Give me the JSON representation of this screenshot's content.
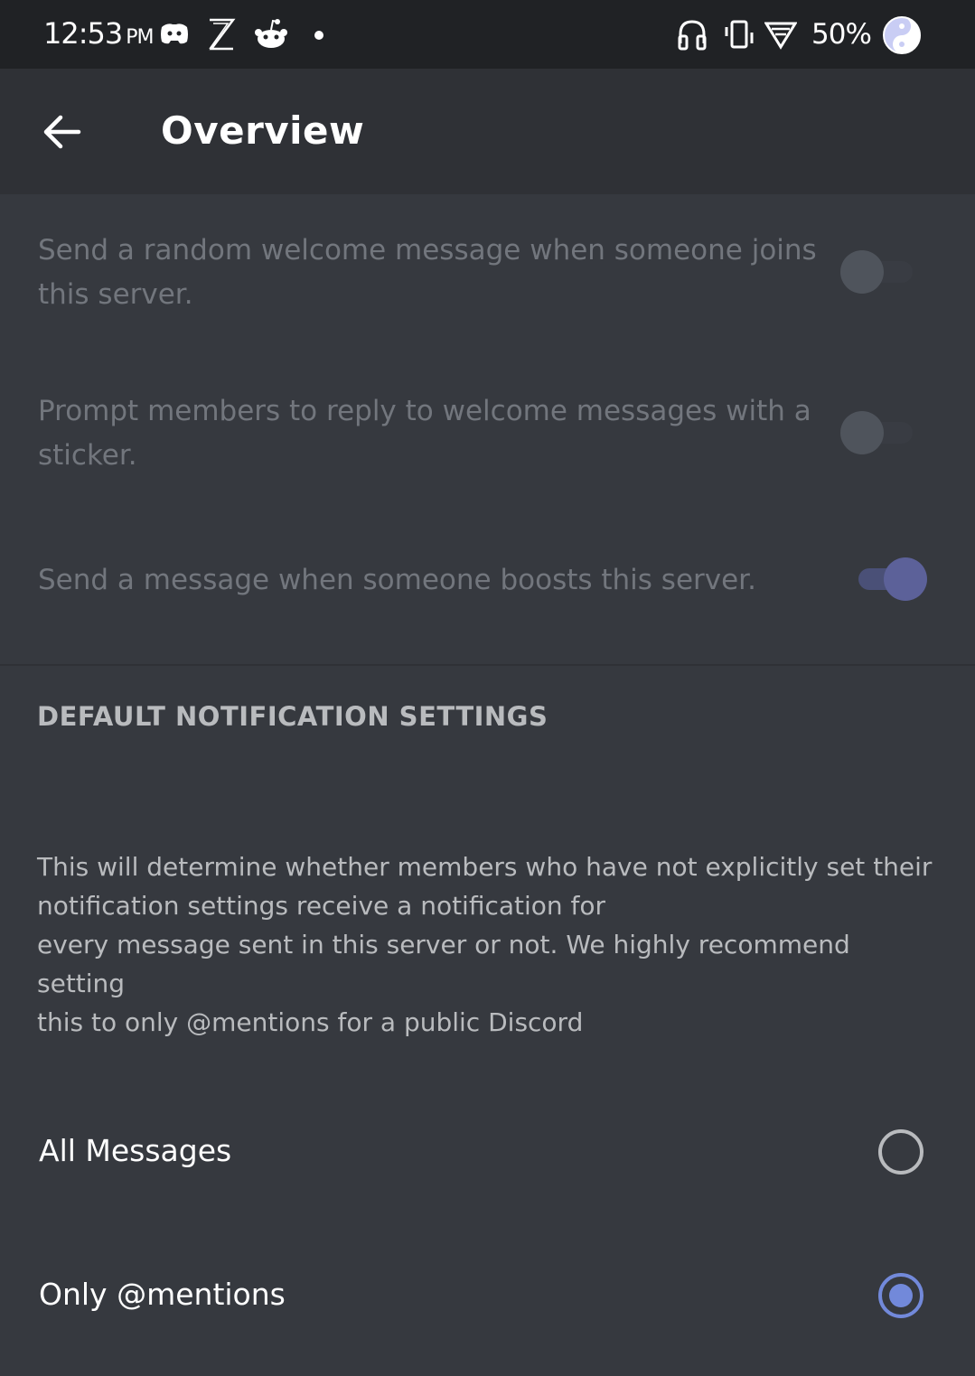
{
  "status_bar": {
    "time": "12:53",
    "ampm": "PM",
    "battery": "50%",
    "left_icons": [
      "discord-icon",
      "z-icon",
      "reddit-icon",
      "dot-icon"
    ],
    "right_icons": [
      "headphones-icon",
      "vibrate-icon",
      "wifi-icon",
      "yin-yang-icon"
    ]
  },
  "app_bar": {
    "title": "Overview",
    "back_icon": "arrow-left-icon"
  },
  "toggles": [
    {
      "label": "Send a random welcome message when someone joins this server.",
      "state": "off"
    },
    {
      "label": "Prompt members to reply to welcome messages with a sticker.",
      "state": "off"
    },
    {
      "label": "Send a message when someone boosts this server.",
      "state": "on"
    }
  ],
  "notifications": {
    "header": "DEFAULT NOTIFICATION SETTINGS",
    "description_lines": [
      "This will determine whether members who have not explicitly set their",
      "notification settings receive a notification for",
      "every message sent in this server or not. We highly recommend setting",
      "this to only @mentions for a public Discord"
    ],
    "options": [
      {
        "label": "All Messages",
        "selected": false
      },
      {
        "label": "Only @mentions",
        "selected": true
      }
    ]
  },
  "colors": {
    "background": "#36393f",
    "app_bar": "#2f3136",
    "status_bar": "#202225",
    "accent": "#7289da"
  }
}
